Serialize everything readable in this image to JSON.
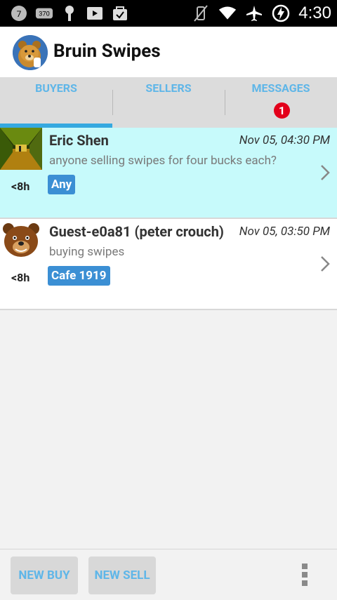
{
  "statusbar": {
    "left_icons": [
      "chat-notification-icon",
      "voicemail-370-icon",
      "keyhole-icon",
      "play-store-icon",
      "shopping-bag-icon"
    ],
    "badge_7": "7",
    "badge_370": "370",
    "time": "4:30"
  },
  "app": {
    "title": "Bruin Swipes"
  },
  "tabs": [
    {
      "label": "BUYERS"
    },
    {
      "label": "SELLERS"
    },
    {
      "label": "MESSAGES",
      "badge": "1"
    }
  ],
  "listings": [
    {
      "name": "Eric Shen",
      "date": "Nov 05, 04:30 PM",
      "message": "anyone selling swipes for four bucks each?",
      "age": "<8h",
      "tag": "Any"
    },
    {
      "name": "Guest-e0a81 (peter crouch)",
      "date": "Nov 05, 03:50 PM",
      "message": "buying swipes",
      "age": "<8h",
      "tag": "Cafe 1919"
    }
  ],
  "bottom": {
    "new_buy": "NEW BUY",
    "new_sell": "NEW SELL"
  },
  "colors": {
    "accent": "#35a9e0",
    "tab_text": "#5fb6e8",
    "tag_bg": "#3b8fd4",
    "selected_row": "#c7fafb",
    "badge": "#e3001b"
  }
}
